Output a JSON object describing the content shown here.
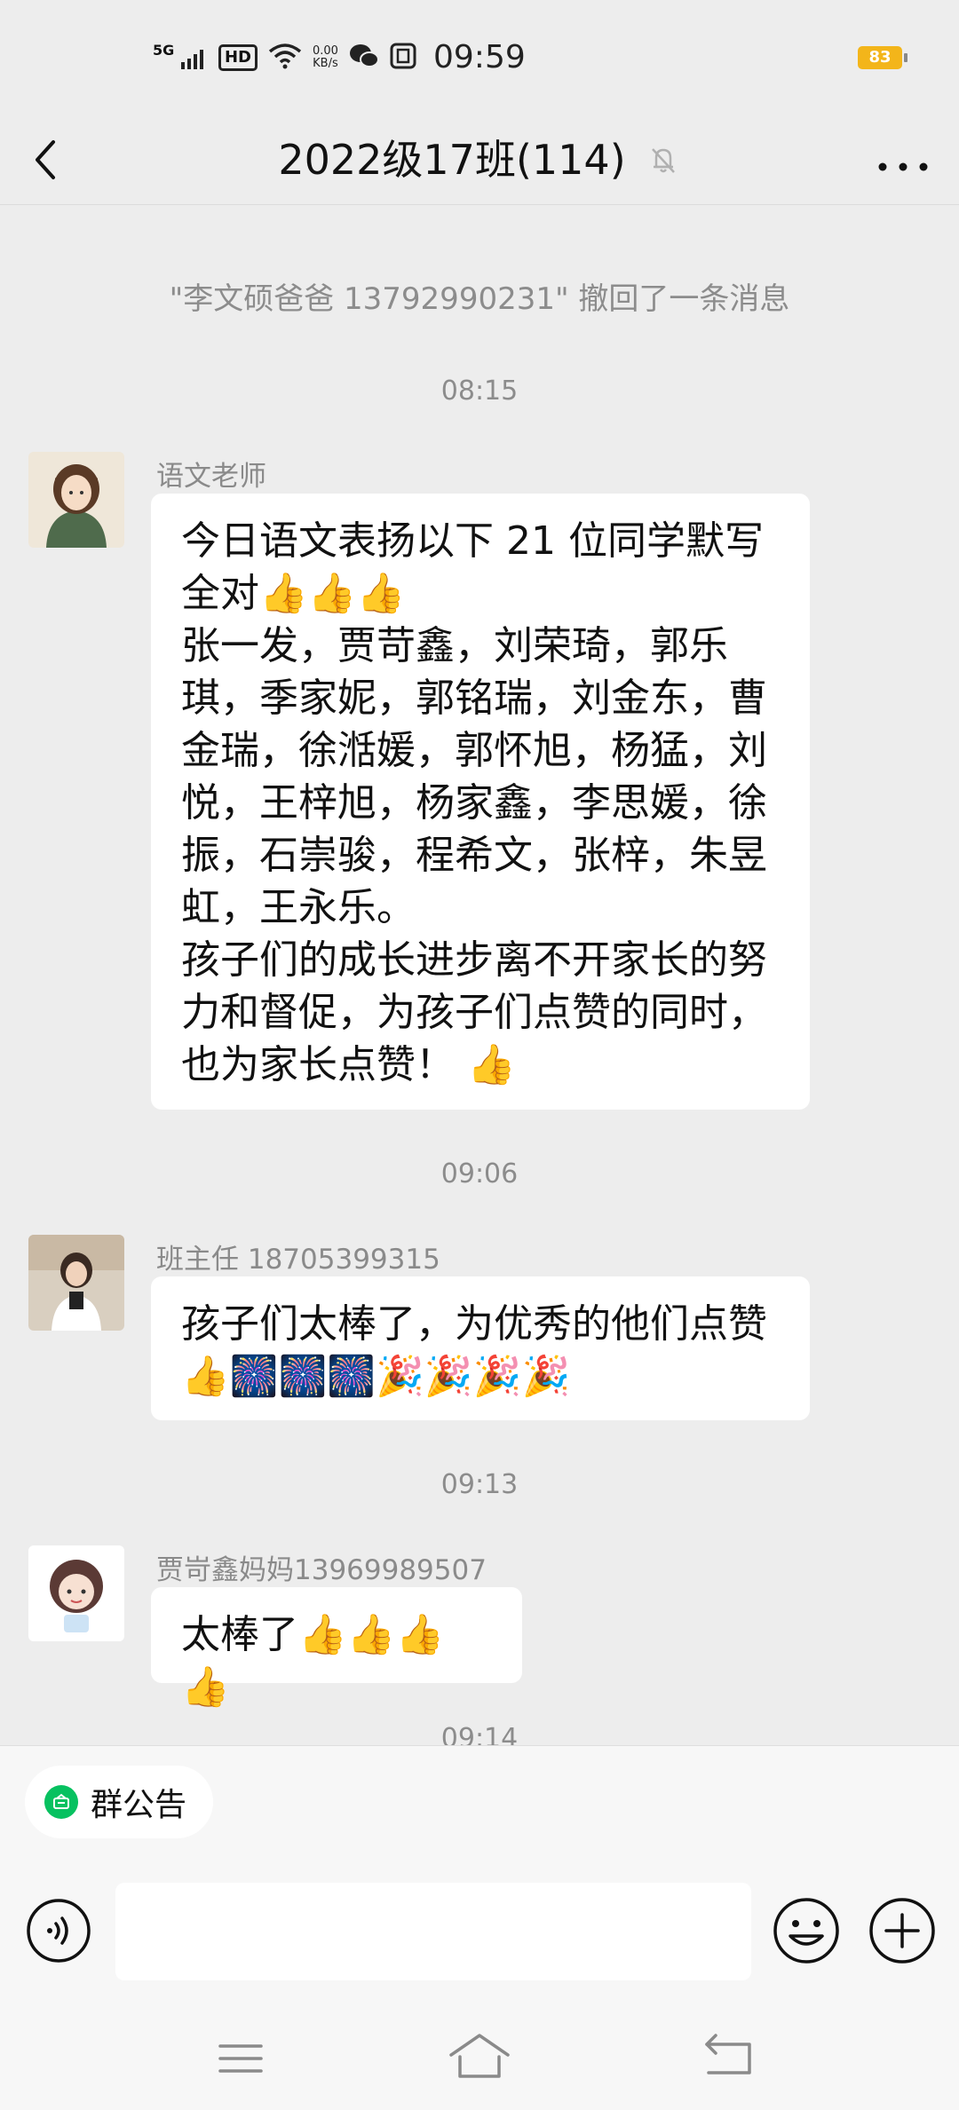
{
  "status_bar": {
    "network": "5G",
    "hd": "HD",
    "speed_value": "0.00",
    "speed_unit": "KB/s",
    "time": "09:59",
    "battery": "83"
  },
  "header": {
    "title": "2022级17班(114)"
  },
  "chat": {
    "partial_top_text": "",
    "recall_notice": "\"李文硕爸爸 13792990231\" 撤回了一条消息",
    "messages": [
      {
        "time": "08:15",
        "sender": "语文老师",
        "lines": [
          "今日语文表扬以下 21 位同学默写",
          "全对👍👍👍",
          "张一发，贾苛鑫，刘荣琦，郭乐",
          "琪，季家妮，郭铭瑞，刘金东，曹",
          "金瑞，徐湉媛，郭怀旭，杨猛，刘",
          "悦，王梓旭，杨家鑫，李思媛，徐",
          "振，石崇骏，程希文，张梓，朱昱",
          "虹，王永乐。",
          "孩子们的成长进步离不开家长的努",
          "力和督促，为孩子们点赞的同时，",
          "也为家长点赞！ 👍"
        ]
      },
      {
        "time": "09:06",
        "sender": "班主任 18705399315",
        "lines": [
          "孩子们太棒了，为优秀的他们点赞",
          "👍🎆🎆🎆🎉🎉🎉🎉"
        ]
      },
      {
        "time": "09:13",
        "sender": "贾岢鑫妈妈13969989507",
        "lines": [
          "太棒了👍👍👍👍"
        ]
      }
    ],
    "next_time_partial": "09:14"
  },
  "bottom": {
    "notice_label": "群公告",
    "input_placeholder": ""
  },
  "colors": {
    "background": "#ededed",
    "bubble": "#ffffff",
    "accent": "#07c160",
    "battery": "#f3b51a"
  }
}
